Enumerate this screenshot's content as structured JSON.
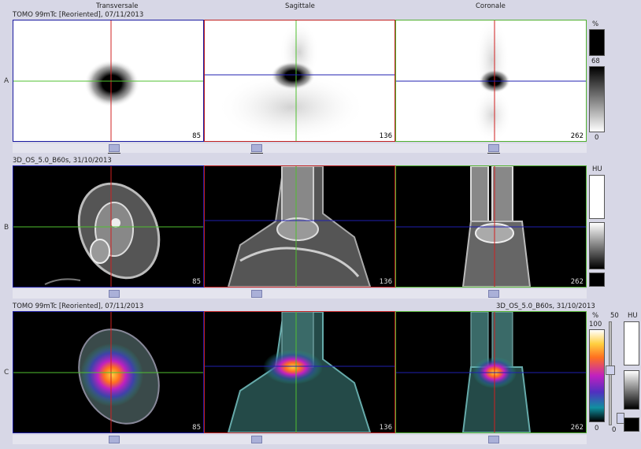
{
  "header": {
    "view_transversale": "Transversale",
    "view_sagittale": "Sagittale",
    "view_coronale": "Coronale"
  },
  "rows": {
    "A": {
      "label": "A",
      "series": "TOMO 99mTc [Reoriented], 07/11/2013"
    },
    "B": {
      "label": "B",
      "series": "3D_OS_5.0_B60s, 31/10/2013"
    },
    "C": {
      "label": "C",
      "series": "TOMO 99mTc [Reoriented], 07/11/2013",
      "series_right": "3D_OS_5.0_B60s, 31/10/2013"
    }
  },
  "slices": {
    "transversale": "85",
    "sagittale": "136",
    "coronale": "262"
  },
  "scales": {
    "a_unit": "%",
    "a_top": "68",
    "a_bottom": "0",
    "b_unit": "HU",
    "c_unit": "%",
    "c_top": "100",
    "c_bottom": "0",
    "c_mid_top": "50",
    "c_mid_bottom": "0",
    "c_hu": "HU"
  },
  "colors": {
    "border_transversale": "#1a1aa0",
    "border_sagittale": "#c02020",
    "border_coronale": "#50b030",
    "crosshair_vertical": "#d02020",
    "crosshair_horizontal_a": "#50c030",
    "crosshair_horizontal_blue": "#2020b0"
  }
}
